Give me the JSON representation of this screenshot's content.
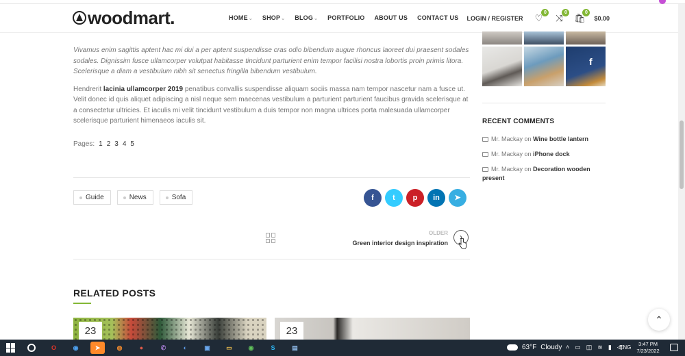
{
  "header": {
    "logo_text": "woodmart.",
    "nav": [
      "HOME",
      "SHOP",
      "BLOG",
      "PORTFOLIO",
      "ABOUT US",
      "CONTACT US"
    ],
    "nav_has_caret": [
      true,
      true,
      true,
      false,
      false,
      false
    ],
    "login_label": "LOGIN / REGISTER",
    "wishlist_count": "0",
    "compare_count": "0",
    "cart_count": "0",
    "cart_total": "$0.00"
  },
  "article": {
    "quote": "Vivamus enim sagittis aptent hac mi dui a per aptent suspendisse cras odio bibendum augue rhoncus laoreet dui praesent sodales sodales. Dignissim fusce ullamcorper volutpat habitasse tincidunt parturient enim tempor facilisi nostra lobortis proin primis litora. Scelerisque a diam a vestibulum nibh sit senectus fringilla bibendum vestibulum.",
    "body_before": "Hendrerit ",
    "body_strong": "lacinia ullamcorper 2019",
    "body_after": " penatibus convallis suspendisse aliquam sociis massa nam tempor nascetur nam a fusce ut. Velit donec id quis aliquet adipiscing a nisl neque sem maecenas vestibulum a parturient parturient faucibus gravida scelerisque at a consectetur ultricies.  Et iaculis mi velit tincidunt vestibulum a duis tempor non magna ultrices porta malesuada ullamcorper scelerisque parturient himenaeos iaculis sit.",
    "pages_label": "Pages:",
    "pages": [
      "1",
      "2",
      "3",
      "4",
      "5"
    ]
  },
  "tags": [
    "Guide",
    "News",
    "Sofa"
  ],
  "share": [
    {
      "icon": "facebook-icon",
      "glyph": "f",
      "color": "#365493"
    },
    {
      "icon": "twitter-icon",
      "glyph": "t",
      "color": "#3cf"
    },
    {
      "icon": "pinterest-icon",
      "glyph": "p",
      "color": "#cb2027"
    },
    {
      "icon": "linkedin-icon",
      "glyph": "in",
      "color": "#0274b3"
    },
    {
      "icon": "telegram-icon",
      "glyph": "➤",
      "color": "#37aee2"
    }
  ],
  "post_nav": {
    "older_label": "OLDER",
    "older_title": "Green interior design inspiration",
    "arrow": "›"
  },
  "related": {
    "title": "RELATED POSTS",
    "cards": [
      {
        "day": "23"
      },
      {
        "day": "23"
      }
    ]
  },
  "sidebar": {
    "recent_comments_title": "RECENT COMMENTS",
    "comments": [
      {
        "author": "Mr. Mackay",
        "on": "on",
        "post": "Wine bottle lantern"
      },
      {
        "author": "Mr. Mackay",
        "on": "on",
        "post": "iPhone dock"
      },
      {
        "author": "Mr. Mackay",
        "on": "on",
        "post": "Decoration wooden present"
      }
    ],
    "gallery_letter": "f"
  },
  "scroll_top_glyph": "⌃",
  "taskbar": {
    "apps": [
      {
        "name": "opera-icon",
        "glyph": "O",
        "color": "#cc1b1b"
      },
      {
        "name": "chrome-icon",
        "glyph": "◉",
        "color": "#3b8ae3"
      },
      {
        "name": "telegram-app-icon",
        "glyph": "➤",
        "color": "#2aa3e0",
        "active": true
      },
      {
        "name": "firefox-icon",
        "glyph": "◍",
        "color": "#e66a1f"
      },
      {
        "name": "app-red-icon",
        "glyph": "●",
        "color": "#d24b3e"
      },
      {
        "name": "viber-icon",
        "glyph": "✆",
        "color": "#7b51a8"
      },
      {
        "name": "app-blue-icon",
        "glyph": "◐",
        "color": "#3b7ad8"
      },
      {
        "name": "app-window-icon",
        "glyph": "▣",
        "color": "#4b8fe0"
      },
      {
        "name": "file-explorer-icon",
        "glyph": "▭",
        "color": "#f2c14e"
      },
      {
        "name": "chrome-2-icon",
        "glyph": "◉",
        "color": "#4aa845"
      },
      {
        "name": "skype-icon",
        "glyph": "S",
        "color": "#16a5e8"
      },
      {
        "name": "app-doc-icon",
        "glyph": "▤",
        "color": "#6fa3d8"
      }
    ],
    "weather_temp": "63°F",
    "weather_text": "Cloudy",
    "lang": "ENG",
    "time": "3:47 PM",
    "date": "7/23/2022"
  }
}
